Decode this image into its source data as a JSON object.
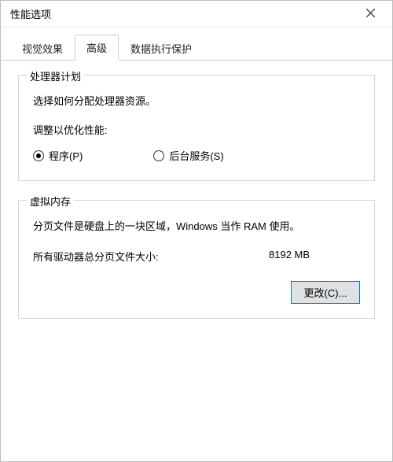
{
  "window": {
    "title": "性能选项",
    "close_icon": "close-icon"
  },
  "tabs": {
    "visual_effects": "视觉效果",
    "advanced": "高级",
    "dep": "数据执行保护",
    "selected": "advanced"
  },
  "processor_scheduling": {
    "legend": "处理器计划",
    "desc": "选择如何分配处理器资源。",
    "sublabel": "调整以优化性能:",
    "option_programs": "程序(P)",
    "option_background": "后台服务(S)",
    "selected": "programs"
  },
  "virtual_memory": {
    "legend": "虚拟内存",
    "desc": "分页文件是硬盘上的一块区域，Windows 当作 RAM 使用。",
    "total_label": "所有驱动器总分页文件大小:",
    "total_value": "8192 MB",
    "change_button": "更改(C)..."
  }
}
